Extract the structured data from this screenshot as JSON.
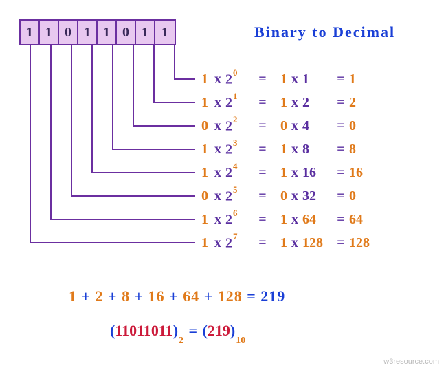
{
  "title": "Binary  to  Decimal",
  "bits": [
    "1",
    "1",
    "0",
    "1",
    "1",
    "0",
    "1",
    "1"
  ],
  "rows": [
    {
      "bit": "1",
      "base": "2",
      "exp": "0",
      "bit2": "1",
      "val": "1",
      "res": "1"
    },
    {
      "bit": "1",
      "base": "2",
      "exp": "1",
      "bit2": "1",
      "val": "2",
      "res": "2"
    },
    {
      "bit": "0",
      "base": "2",
      "exp": "2",
      "bit2": "0",
      "val": "4",
      "res": "0"
    },
    {
      "bit": "1",
      "base": "2",
      "exp": "3",
      "bit2": "1",
      "val": "8",
      "res": "8"
    },
    {
      "bit": "1",
      "base": "2",
      "exp": "4",
      "bit2": "1",
      "val": "16",
      "res": "16"
    },
    {
      "bit": "0",
      "base": "2",
      "exp": "5",
      "bit2": "0",
      "val": "32",
      "res": "0"
    },
    {
      "bit": "1",
      "base": "2",
      "exp": "6",
      "bit2": "1",
      "val": "64",
      "res": "64"
    },
    {
      "bit": "1",
      "base": "2",
      "exp": "7",
      "bit2": "1",
      "val": "128",
      "res": "128"
    }
  ],
  "op_x": "x",
  "op_eq": "=",
  "op_plus": "+",
  "sum": {
    "terms": [
      "1",
      "2",
      "8",
      "16",
      "64",
      "128"
    ],
    "total": "219"
  },
  "final": {
    "lparen": "(",
    "rparen": ")",
    "bin": "11011011",
    "bin_base": "2",
    "eq": "=",
    "dec": "219",
    "dec_base": "10"
  },
  "watermark": "w3resource.com"
}
